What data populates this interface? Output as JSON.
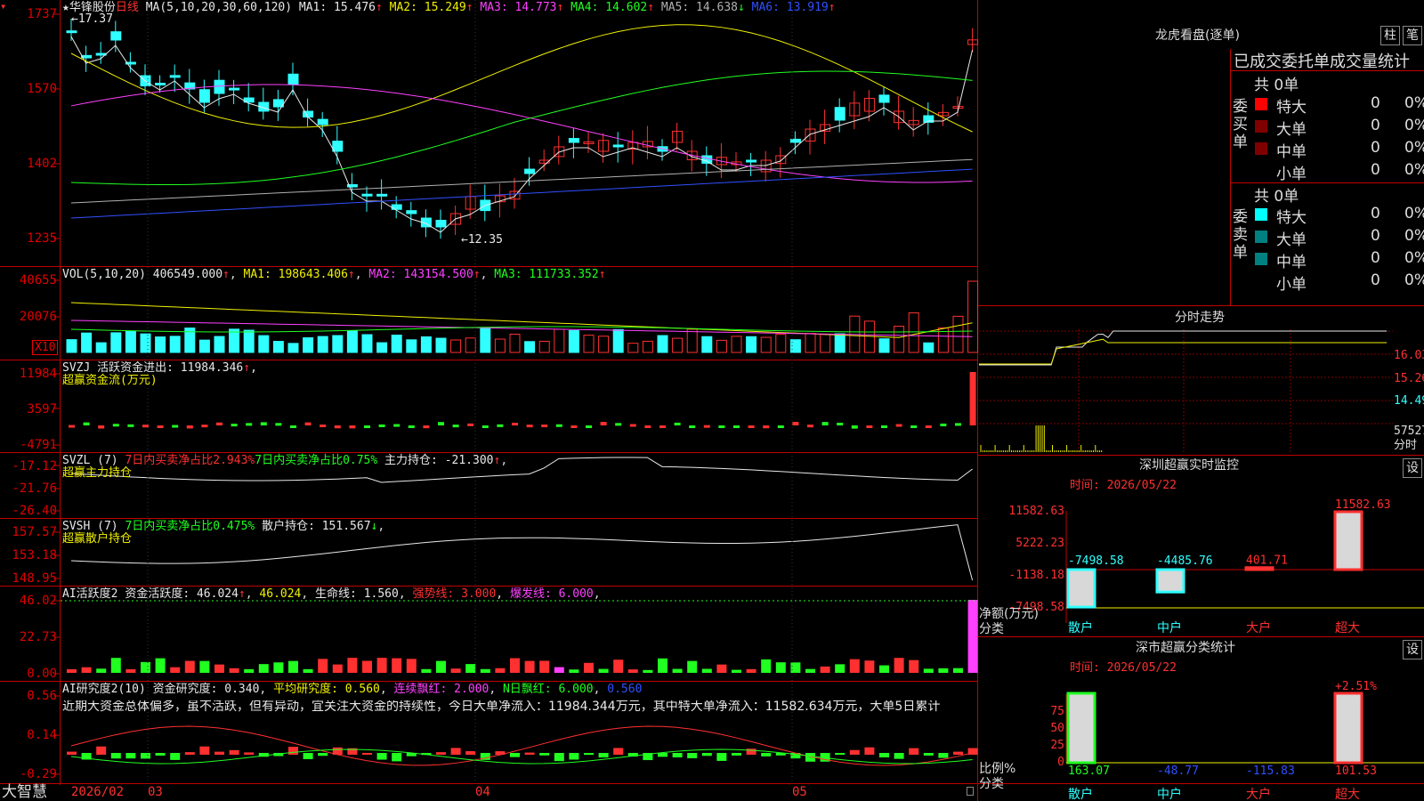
{
  "price_panel": {
    "stock_name": "华锋股份",
    "period": "日线",
    "ma_params": "MA(5,10,20,30,60,120)",
    "ma": [
      {
        "label": "MA1: 15.476",
        "color": "#e8e8e8",
        "arrow": "↑"
      },
      {
        "label": "MA2: 15.249",
        "color": "#f0f000",
        "arrow": "↑"
      },
      {
        "label": "MA3: 14.773",
        "color": "#ff40ff",
        "arrow": "↑"
      },
      {
        "label": "MA4: 14.602",
        "color": "#20ff20",
        "arrow": "↑"
      },
      {
        "label": "MA5: 14.638",
        "color": "#b0b0b0",
        "arrow": "↓"
      },
      {
        "label": "MA6: 13.919",
        "color": "#3050ff",
        "arrow": "↑"
      }
    ],
    "yticks": [
      "1737",
      "1570",
      "1402",
      "1235"
    ],
    "high_label": "17.37",
    "low_label": "12.35"
  },
  "vol_panel": {
    "title": "VOL(5,10,20)",
    "value": "406549.000",
    "ma1": "MA1: 198643.406",
    "ma2": "MA2: 143154.500",
    "ma3": "MA3: 111733.352",
    "yticks": [
      "40655",
      "20076"
    ],
    "unit": "X10"
  },
  "svzj_panel": {
    "title": "SVZJ",
    "label": "活跃资金进出:",
    "value": "11984.346",
    "subtitle": "超赢资金流(万元)",
    "yticks": [
      "11984",
      "3597",
      "-4791"
    ]
  },
  "svzl_panel": {
    "title": "SVZL (7)",
    "t1": "7日内买卖净占比2.943%",
    "t2": "7日内买卖净占比0.75%",
    "t3": "主力持仓: -21.300",
    "subtitle": "超赢主力持仓",
    "yticks": [
      "-17.12",
      "-21.76",
      "-26.40"
    ]
  },
  "svsh_panel": {
    "title": "SVSH (7)",
    "t1": "7日内买卖净占比0.475%",
    "t2": "散户持仓: 151.567",
    "subtitle": "超赢散户持仓",
    "yticks": [
      "157.57",
      "153.18",
      "148.95"
    ]
  },
  "ai_active": {
    "title": "AI活跃度2",
    "t1": "资金活跃度: 46.024",
    "t2": "46.024",
    "t3": "生命线: 1.560",
    "t4": "强势线: 3.000",
    "t5": "爆发线: 6.000",
    "yticks": [
      "46.02",
      "22.73",
      "0.00"
    ]
  },
  "ai_research": {
    "title": "AI研究度2(10)",
    "t1": "资金研究度: 0.340",
    "t2": "平均研究度: 0.560",
    "t3": "连续飘红: 2.000",
    "t4": "N日飘红: 6.000",
    "t5": "0.560",
    "comment": "近期大资金总体偏多，虽不活跃，但有异动，宜关注大资金的持续性，今日大单净流入：11984.344万元，其中特大单净流入：11582.634万元，大单5日累计",
    "yticks": [
      "0.56",
      "0.14",
      "-0.29"
    ]
  },
  "bottom_bar": {
    "brand": "大智慧",
    "dates": [
      "2026/02",
      "03",
      "04",
      "05"
    ]
  },
  "right": {
    "dragon_title": "龙虎看盘(逐单)",
    "btn_zhu": "柱",
    "btn_bi": "笔",
    "table_header": "已成交委托单成交量统计",
    "buy_label": "委买单",
    "sell_label": "委卖单",
    "buy_total": "共 0单",
    "sell_total": "共 0单",
    "buy_rows": [
      {
        "name": "特大",
        "color": "#ff0000",
        "v": "0",
        "p": "0%"
      },
      {
        "name": "大单",
        "color": "#800000",
        "v": "0",
        "p": "0%"
      },
      {
        "name": "中单",
        "color": "#800000",
        "v": "0",
        "p": "0%"
      },
      {
        "name": "小单",
        "color": "#000000",
        "v": "0",
        "p": "0%"
      }
    ],
    "sell_rows": [
      {
        "name": "特大",
        "color": "#00ffff",
        "v": "0",
        "p": "0%"
      },
      {
        "name": "大单",
        "color": "#008080",
        "v": "0",
        "p": "0%"
      },
      {
        "name": "中单",
        "color": "#008080",
        "v": "0",
        "p": "0%"
      },
      {
        "name": "小单",
        "color": "#000000",
        "v": "0",
        "p": "0%"
      }
    ],
    "intraday_title": "分时走势",
    "intraday_ticks": [
      "16.03",
      "15.26",
      "14.49",
      "57527",
      "分时"
    ],
    "monitor_title": "深圳超赢实时监控",
    "monitor_btn": "设",
    "monitor_time": "时间: 2026/05/22",
    "monitor_yticks": [
      "11582.63",
      "5222.23",
      "-1138.18",
      "-7498.58"
    ],
    "monitor_unit": "净额(万元)",
    "monitor_cat": "分类",
    "monitor_bars": [
      {
        "cat": "散户",
        "value": -7498.58,
        "label": "-7498.58"
      },
      {
        "cat": "中户",
        "value": -4485.76,
        "label": "-4485.76"
      },
      {
        "cat": "大户",
        "value": 401.71,
        "label": "401.71"
      },
      {
        "cat": "超大",
        "value": 11582.63,
        "label": "11582.63"
      }
    ],
    "class_title": "深市超赢分类统计",
    "class_btn": "设",
    "class_time": "时间: 2026/05/22",
    "class_yticks": [
      "75",
      "50",
      "25",
      "0"
    ],
    "class_unit": "比例%",
    "class_cat": "分类",
    "class_top_label": "+2.51%",
    "class_bars": [
      {
        "cat": "散户",
        "value": 163.07,
        "label": "163.07"
      },
      {
        "cat": "中户",
        "value": -48.77,
        "label": "-48.77"
      },
      {
        "cat": "大户",
        "value": -115.83,
        "label": "-115.83"
      },
      {
        "cat": "超大",
        "value": 101.53,
        "label": "101.53"
      }
    ]
  }
}
